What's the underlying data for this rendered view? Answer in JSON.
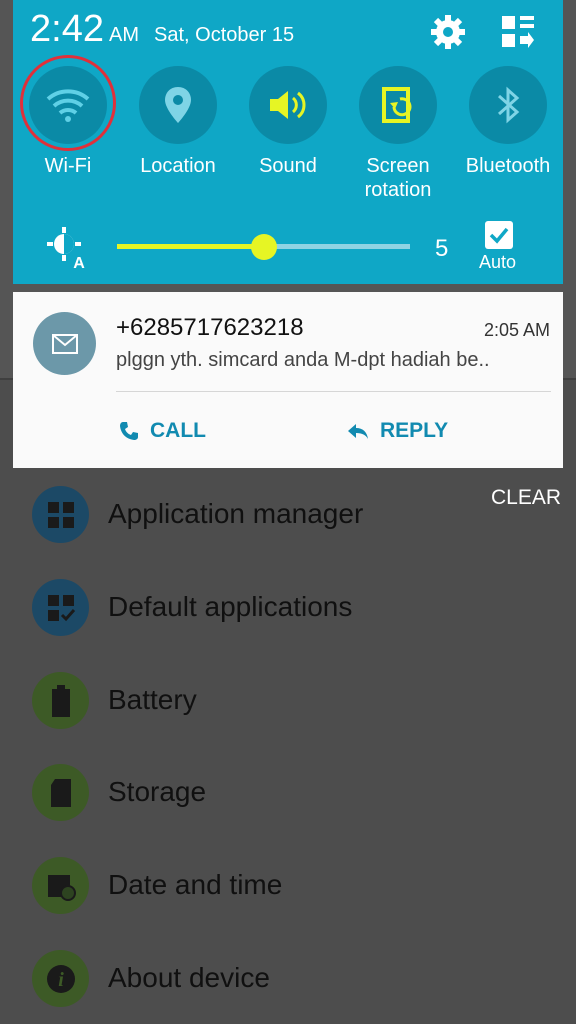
{
  "status": {
    "time": "2:42",
    "ampm": "AM",
    "date": "Sat, October 15"
  },
  "header_icons": [
    "settings-gear-icon",
    "edit-grid-icon"
  ],
  "quick_settings": [
    {
      "label": "Wi-Fi",
      "icon": "wifi-icon",
      "active": true
    },
    {
      "label": "Location",
      "icon": "location-pin-icon",
      "active": false
    },
    {
      "label": "Sound",
      "icon": "speaker-icon",
      "active": true
    },
    {
      "label": "Screen rotation",
      "icon": "rotation-icon",
      "active": true
    },
    {
      "label": "Bluetooth",
      "icon": "bluetooth-icon",
      "active": false
    }
  ],
  "brightness": {
    "value": "5",
    "level": 0.5,
    "auto_label": "Auto",
    "auto_checked": true
  },
  "notification": {
    "sender": "+6285717623218",
    "time": "2:05 AM",
    "message": "plggn yth. simcard anda    M-dpt hadiah   be..",
    "actions": {
      "call": "CALL",
      "reply": "REPLY"
    }
  },
  "clear_label": "CLEAR",
  "settings_list": [
    {
      "label": "Application manager",
      "icon": "app-grid-icon"
    },
    {
      "label": "Default applications",
      "icon": "default-apps-icon"
    },
    {
      "label": "Battery",
      "icon": "battery-icon"
    },
    {
      "label": "Storage",
      "icon": "sd-card-icon"
    },
    {
      "label": "Date and time",
      "icon": "calendar-clock-icon"
    },
    {
      "label": "About device",
      "icon": "info-icon"
    }
  ],
  "colors": {
    "panel": "#0fa7c6",
    "accent_yellow": "#e6f524",
    "action_blue": "#118ab0",
    "wifi_ring": "#e0303a"
  }
}
